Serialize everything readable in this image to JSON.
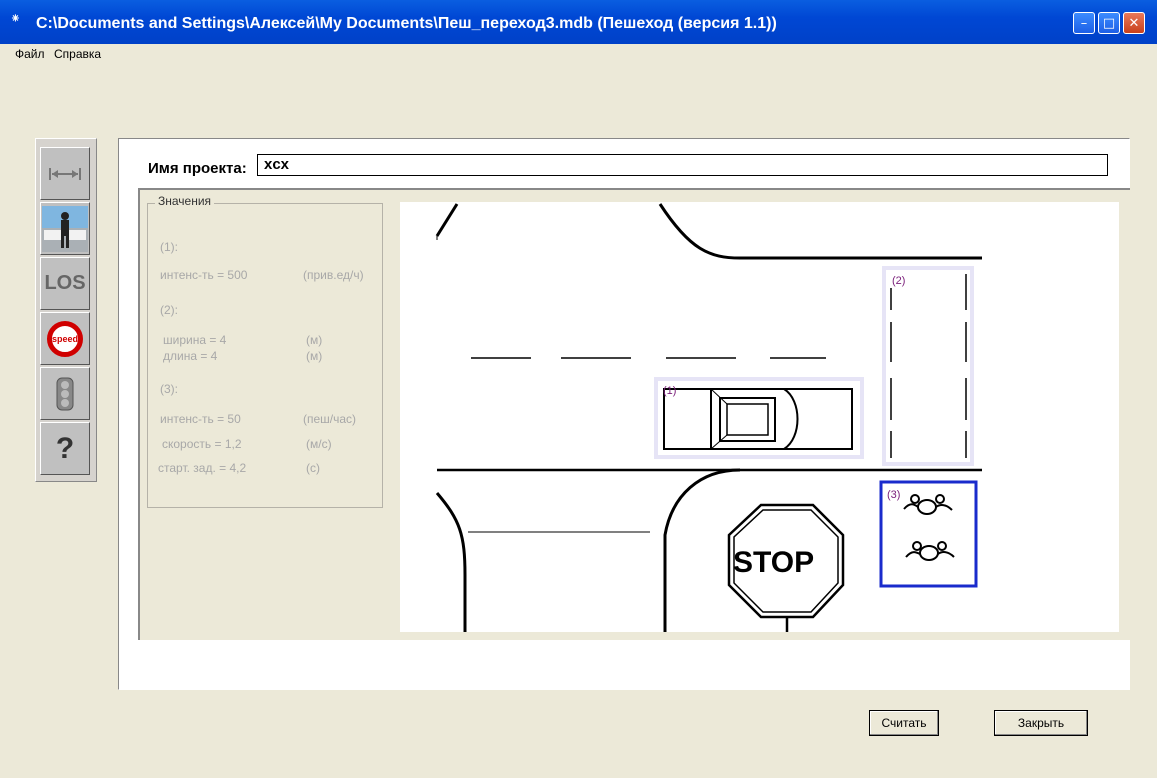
{
  "window": {
    "title": "C:\\Documents and Settings\\Алексей\\My Documents\\Пеш_переход3.mdb (Пешеход (версия 1.1))",
    "minimize": "–",
    "maximize": "□",
    "close": "✕"
  },
  "menu": {
    "file": "Файл",
    "help": "Справка"
  },
  "toolbar": {
    "icons": [
      "distance-icon",
      "pedestrian-photo-icon",
      "los-icon",
      "speed-sign-icon",
      "traffic-light-icon",
      "help-icon"
    ],
    "los_label": "LOS",
    "speed_label": "speed",
    "help_label": "?"
  },
  "project": {
    "label": "Имя проекта:",
    "value": "xcx"
  },
  "values": {
    "title": "Значения",
    "s1_label": "(1):",
    "s1_intensity_label": "интенс-ть  =  500",
    "s1_intensity_unit": "(прив.ед/ч)",
    "s2_label": "(2):",
    "s2_width_label": "ширина    =  4",
    "s2_width_unit": "(м)",
    "s2_length_label": "длина      =  4",
    "s2_length_unit": "(м)",
    "s3_label": "(3):",
    "s3_intensity_label": "интенс-ть  =  50",
    "s3_intensity_unit": "(пеш/час)",
    "s3_speed_label": "скорость  =  1,2",
    "s3_speed_unit": "(м/с)",
    "s3_delay_label": "старт. зад. =  4,2",
    "s3_delay_unit": "(с)"
  },
  "scene": {
    "car_label": "(1)",
    "crosswalk_label": "(2)",
    "pedestrians_label": "(3)",
    "stop_text": "STOP",
    "marker_color": "#e6e4f6",
    "selected_color": "#1a2bcc",
    "label_color": "#7a1e7a"
  },
  "buttons": {
    "read": "Считать",
    "close": "Закрыть"
  }
}
